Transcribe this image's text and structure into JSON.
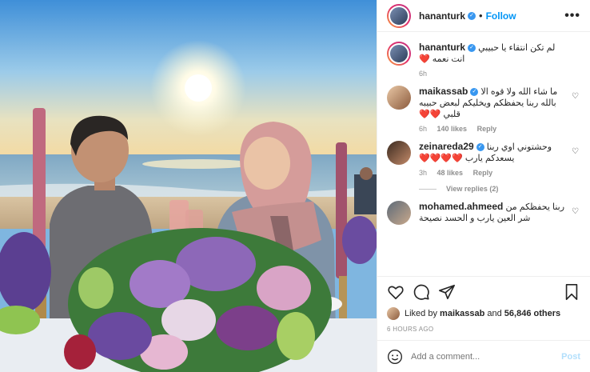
{
  "post": {
    "username": "hananturk",
    "follow_label": "Follow",
    "more_label": "•••"
  },
  "comments": [
    {
      "username": "hananturk",
      "text": "لم تكن انتقاء يا حبيبي انت نعمه ❤️",
      "time": "6h",
      "likes": "",
      "reply": ""
    },
    {
      "username": "maikassab",
      "text": "ما شاء الله ولا قوه الا بالله ربنا يحفظكم ويخليكم لبعض حبيبه قلبي ❤️❤️",
      "time": "6h",
      "likes": "140 likes",
      "reply": "Reply"
    },
    {
      "username": "zeinareda29",
      "text": "وحشتوني اوي ربنا يسعدكم يارب ❤️❤️❤️❤️",
      "time": "3h",
      "likes": "48 likes",
      "reply": "Reply"
    },
    {
      "username": "mohamed.ahmeed",
      "text": "ربنا يحفظكم من شر العين يارب و الحسد نصيحة",
      "time": "",
      "likes": "",
      "reply": ""
    }
  ],
  "view_replies": "View replies (2)",
  "likes_line": {
    "prefix": "Liked by",
    "first": "maikassab",
    "middle": "and",
    "others": "56,846 others"
  },
  "timestamp": "6 HOURS AGO",
  "add_comment": {
    "placeholder": "Add a comment...",
    "post_label": "Post"
  },
  "colors": {
    "accent": "#0095f6",
    "verified": "#3897f0"
  }
}
